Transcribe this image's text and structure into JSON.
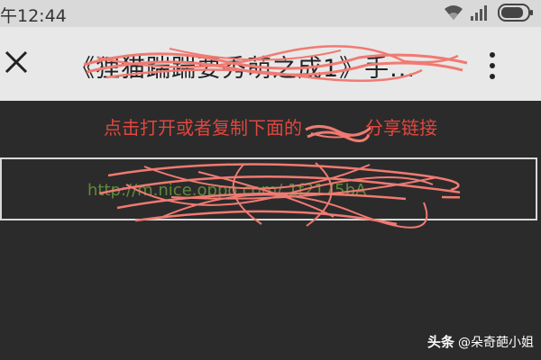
{
  "status_bar": {
    "time": "午12:44",
    "icons": [
      "wifi-icon",
      "signal-icon",
      "battery-icon"
    ]
  },
  "title_bar": {
    "title": "《狸猫踹踹要秀萌之成1》手...",
    "close_icon": "close-icon",
    "more_icon": "more-vertical-icon"
  },
  "content": {
    "instruction_prefix": "点击打开或者复制下面的",
    "instruction_suffix": "分享链接",
    "link_text": "http://m.nice.oppo.com/ 1f2175bA"
  },
  "watermark": {
    "brand": "头条",
    "handle": "@朵奇葩小姐"
  },
  "colors": {
    "instruction_red": "#e0473f",
    "scribble_red": "#f07a72",
    "link_green": "#5f8a3b",
    "title_bar_bg": "#e8e8e8",
    "content_bg": "#2b2b2b"
  }
}
